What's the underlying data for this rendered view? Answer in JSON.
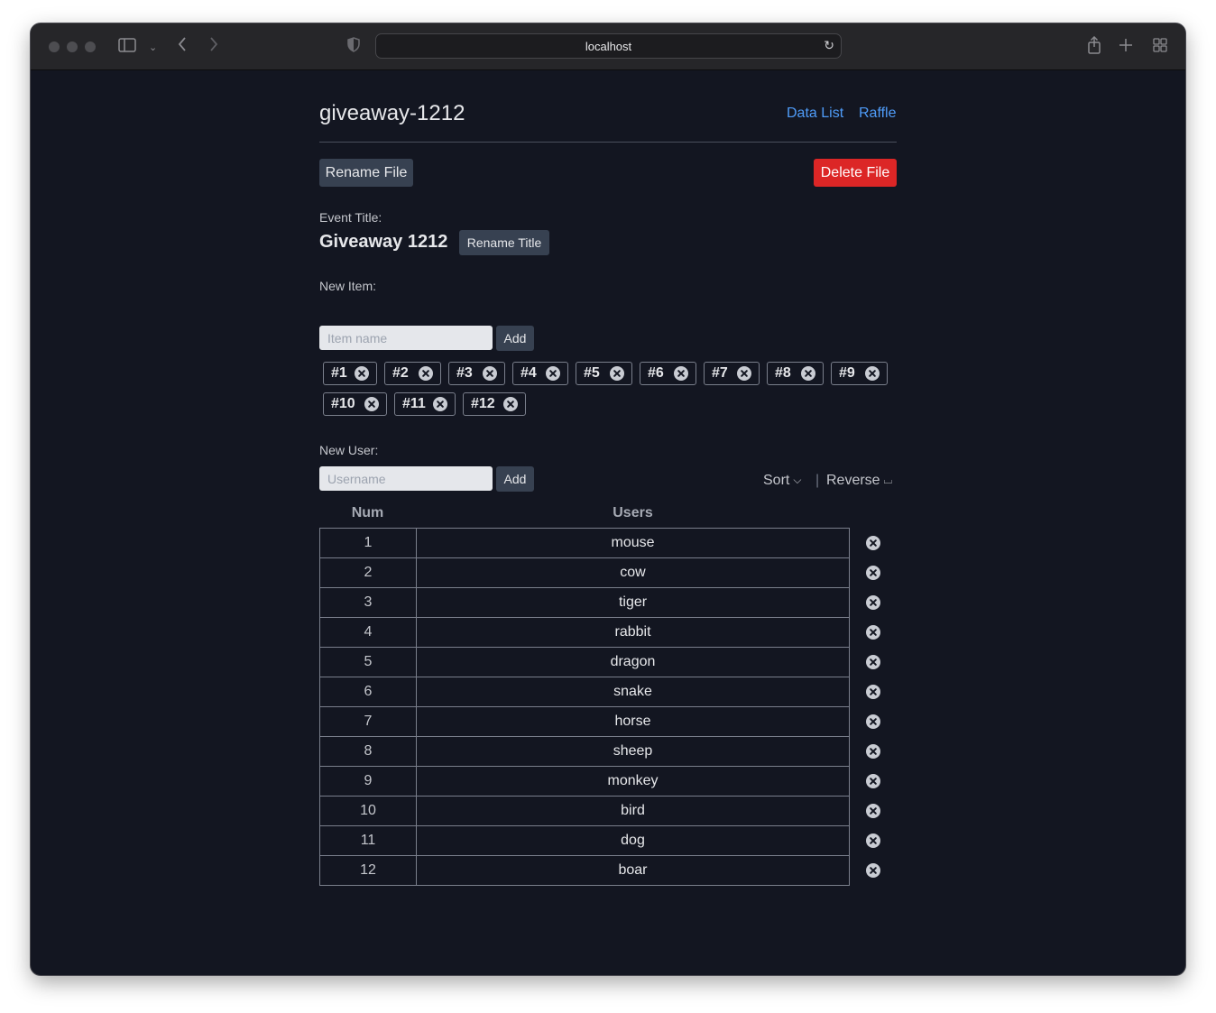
{
  "browser": {
    "url": "localhost"
  },
  "header": {
    "title": "giveaway-1212",
    "links": [
      "Data List",
      "Raffle"
    ]
  },
  "file_actions": {
    "rename_label": "Rename File",
    "delete_label": "Delete File"
  },
  "event": {
    "label": "Event Title:",
    "title": "Giveaway 1212",
    "rename_label": "Rename Title"
  },
  "new_item": {
    "label": "New Item:",
    "placeholder": "Item name",
    "add_label": "Add",
    "items": [
      "#1",
      "#2",
      "#3",
      "#4",
      "#5",
      "#6",
      "#7",
      "#8",
      "#9",
      "#10",
      "#11",
      "#12"
    ]
  },
  "new_user": {
    "label": "New User:",
    "placeholder": "Username",
    "add_label": "Add"
  },
  "controls": {
    "sort_label": "Sort",
    "separator": "|",
    "reverse_label": "Reverse"
  },
  "users_table": {
    "headers": [
      "Num",
      "Users"
    ],
    "rows": [
      {
        "num": "1",
        "user": "mouse"
      },
      {
        "num": "2",
        "user": "cow"
      },
      {
        "num": "3",
        "user": "tiger"
      },
      {
        "num": "4",
        "user": "rabbit"
      },
      {
        "num": "5",
        "user": "dragon"
      },
      {
        "num": "6",
        "user": "snake"
      },
      {
        "num": "7",
        "user": "horse"
      },
      {
        "num": "8",
        "user": "sheep"
      },
      {
        "num": "9",
        "user": "monkey"
      },
      {
        "num": "10",
        "user": "bird"
      },
      {
        "num": "11",
        "user": "dog"
      },
      {
        "num": "12",
        "user": "boar"
      }
    ]
  },
  "colors": {
    "background": "#131621",
    "link": "#4f9cf9",
    "danger": "#dc2626",
    "button": "#374151"
  }
}
